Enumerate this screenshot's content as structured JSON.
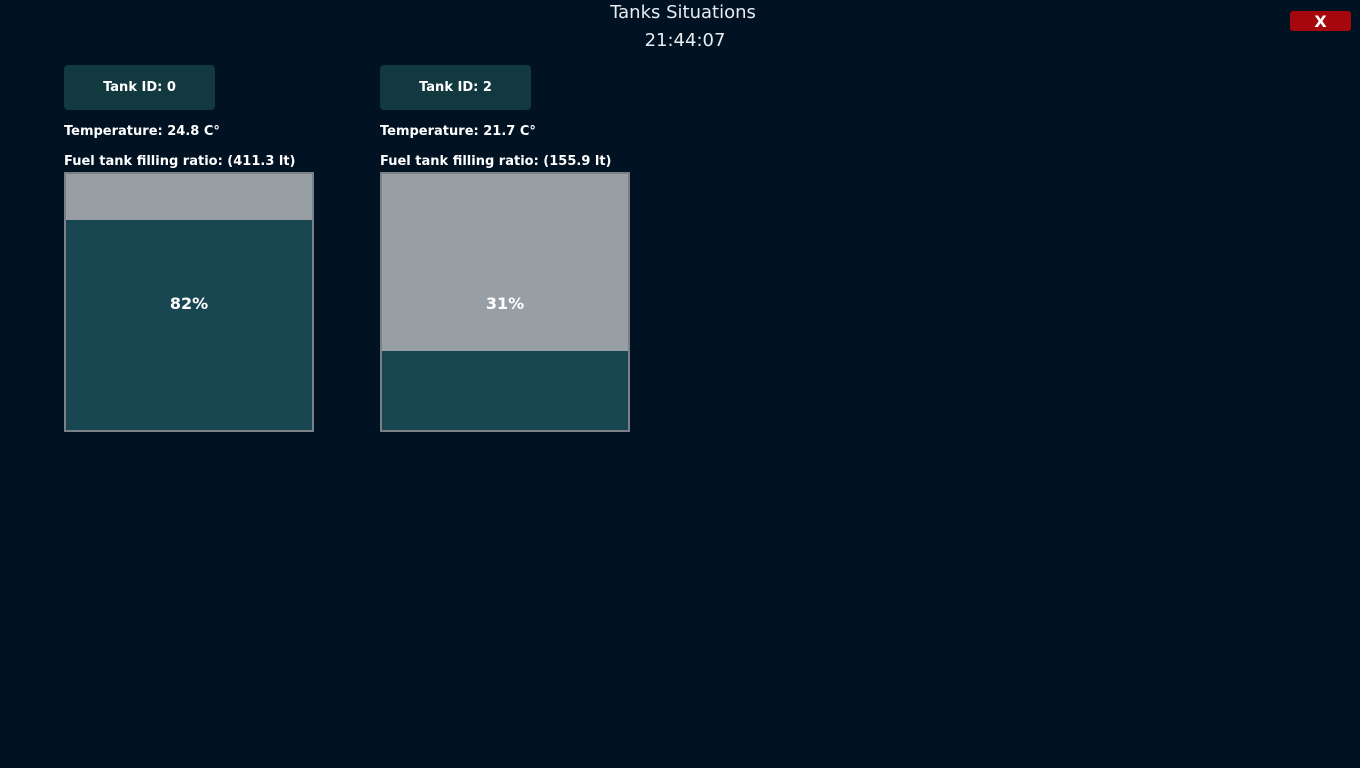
{
  "header": {
    "title": "Tanks Situations",
    "clock": "21:44:07"
  },
  "close_button": {
    "label": "X"
  },
  "colors": {
    "background": "#011223",
    "tank_button": "#12393f",
    "gauge_empty": "#979ea4",
    "gauge_fill": "#184751",
    "close_button": "#a6070d"
  },
  "tanks": [
    {
      "id_label": "Tank ID: 0",
      "temperature": "Temperature: 24.8 C°",
      "fuel": "Fuel tank filling ratio: (411.3 lt)",
      "fill_percent": 82,
      "fill_label": "82%"
    },
    {
      "id_label": "Tank ID: 2",
      "temperature": "Temperature: 21.7 C°",
      "fuel": "Fuel tank filling ratio: (155.9 lt)",
      "fill_percent": 31,
      "fill_label": "31%"
    }
  ]
}
